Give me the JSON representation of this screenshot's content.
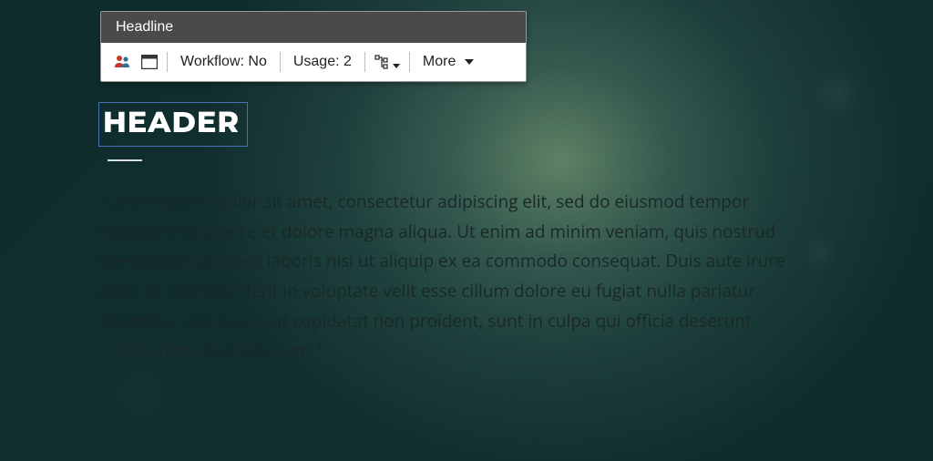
{
  "toolbar": {
    "title": "Headline",
    "workflow_label": "Workflow: No",
    "usage_label": "Usage: 2",
    "more_label": "More"
  },
  "content": {
    "header": "HEADER",
    "body": "\"Lorem ipsum dolor sit amet, consectetur adipiscing elit, sed do eiusmod tempor incididunt ut labore et dolore magna aliqua. Ut enim ad minim veniam, quis nostrud exercitation ullamco laboris nisi ut aliquip ex ea commodo consequat. Duis aute irure dolor in reprehenderit in voluptate velit esse cillum dolore eu fugiat nulla pariatur. Excepteur sint occaecat cupidatat non proident, sunt in culpa qui officia deserunt mollit anim id est laborum.\""
  }
}
